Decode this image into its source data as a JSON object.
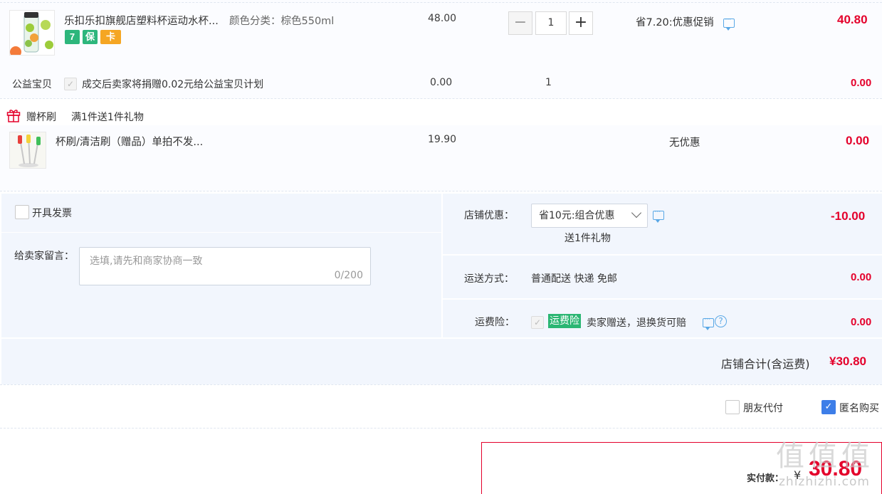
{
  "item1": {
    "title": "乐扣乐扣旗舰店塑料杯运动水杯...",
    "sku": "颜色分类：棕色550ml",
    "unit_price": "48.00",
    "qty": "1",
    "minus": "−",
    "plus": "+",
    "promo": "省7.20:优惠促销",
    "subtotal": "40.80",
    "badges": [
      {
        "text": "7",
        "color": "#2db67c"
      },
      {
        "text": "保",
        "color": "#2db67c"
      },
      {
        "text": "卡",
        "color": "#f5a623"
      }
    ]
  },
  "charity": {
    "label": "公益宝贝",
    "text": "成交后卖家将捐赠0.02元给公益宝贝计划",
    "price": "0.00",
    "qty": "1",
    "subtotal": "0.00",
    "check": "✓"
  },
  "gift": {
    "tag": "赠杯刷",
    "desc": "满1件送1件礼物",
    "title": "杯刷/清洁刷（赠品）单拍不发...",
    "price": "19.90",
    "promo": "无优惠",
    "subtotal": "0.00"
  },
  "invoice": {
    "label": "开具发票"
  },
  "message": {
    "label": "给卖家留言：",
    "placeholder": "选填,请先和商家协商一致",
    "counter": "0/200"
  },
  "shop_discount": {
    "label": "店铺优惠：",
    "selected": "省10元:组合优惠",
    "note": "送1件礼物",
    "amount": "-10.00"
  },
  "shipping": {
    "label": "运送方式：",
    "value": "普通配送 快递 免邮",
    "amount": "0.00"
  },
  "insurance": {
    "label": "运费险：",
    "tag": "运费险",
    "text": "卖家赠送，退换货可赔",
    "help": "?",
    "amount": "0.00",
    "check": "✓"
  },
  "shop_total": {
    "label": "店铺合计(含运费)",
    "amount": "¥30.80"
  },
  "options": {
    "friend_pay": "朋友代付",
    "anonymous": "匿名购买",
    "check": "✓"
  },
  "payment": {
    "label": "实付款：",
    "currency": "¥",
    "amount": "30.80"
  },
  "watermark": {
    "chars": [
      "值",
      "值",
      "值"
    ],
    "site": "zhizhizhi.com"
  },
  "colors": {
    "accent_red": "#e4002b",
    "check_blue": "#3d7ee8",
    "tag_green": "#2bb673"
  }
}
